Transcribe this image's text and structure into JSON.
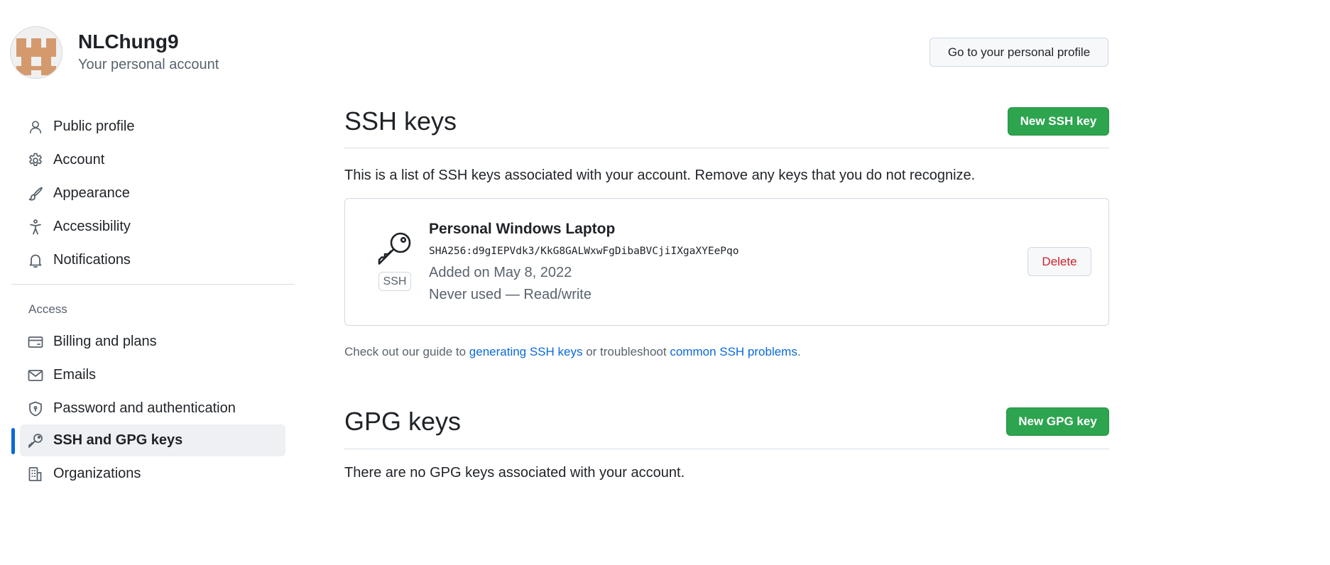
{
  "account": {
    "username": "NLChung9",
    "subtitle": "Your personal account",
    "profile_button": "Go to your personal profile"
  },
  "sidebar": {
    "items": [
      {
        "label": "Public profile",
        "icon": "person-icon"
      },
      {
        "label": "Account",
        "icon": "gear-icon"
      },
      {
        "label": "Appearance",
        "icon": "paintbrush-icon"
      },
      {
        "label": "Accessibility",
        "icon": "accessibility-icon"
      },
      {
        "label": "Notifications",
        "icon": "bell-icon"
      }
    ],
    "access_heading": "Access",
    "access_items": [
      {
        "label": "Billing and plans",
        "icon": "credit-card-icon"
      },
      {
        "label": "Emails",
        "icon": "mail-icon"
      },
      {
        "label": "Password and authentication",
        "icon": "shield-lock-icon"
      },
      {
        "label": "SSH and GPG keys",
        "icon": "key-icon",
        "active": true
      },
      {
        "label": "Organizations",
        "icon": "organization-icon"
      }
    ]
  },
  "ssh": {
    "title": "SSH keys",
    "new_button": "New SSH key",
    "intro": "This is a list of SSH keys associated with your account. Remove any keys that you do not recognize.",
    "key": {
      "name": "Personal Windows Laptop",
      "fingerprint": "SHA256:d9gIEPVdk3/KkG8GALWxwFgDibaBVCjiIXgaXYEePqo",
      "added": "Added on May 8, 2022",
      "usage": "Never used — Read/write",
      "type_label": "SSH",
      "delete_button": "Delete"
    },
    "guide": {
      "prefix": "Check out our guide to ",
      "link1": "generating SSH keys",
      "middle": " or troubleshoot ",
      "link2": "common SSH problems",
      "suffix": "."
    }
  },
  "gpg": {
    "title": "GPG keys",
    "new_button": "New GPG key",
    "partial_text": "There are no GPG keys associated with your account."
  },
  "colors": {
    "accent_blue": "#0969da",
    "primary_green": "#2da44e",
    "danger_red": "#cf222e",
    "avatar_tan": "#d49a6e"
  }
}
